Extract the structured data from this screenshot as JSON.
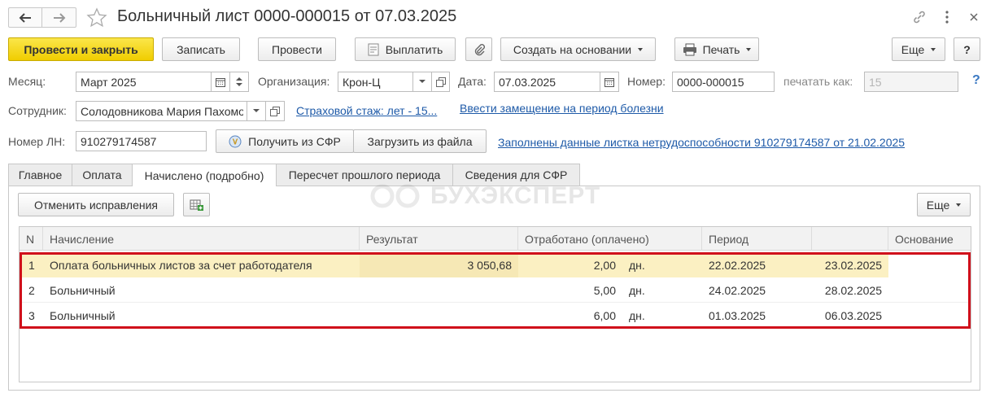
{
  "title": "Больничный лист 0000-000015 от 07.03.2025",
  "toolbar": {
    "post_close": "Провести и закрыть",
    "save": "Записать",
    "post": "Провести",
    "pay": "Выплатить",
    "create_based": "Создать на основании",
    "print": "Печать",
    "more": "Еще",
    "help": "?"
  },
  "form": {
    "month_label": "Месяц:",
    "month_value": "Март 2025",
    "org_label": "Организация:",
    "org_value": "Крон-Ц",
    "date_label": "Дата:",
    "date_value": "07.03.2025",
    "number_label": "Номер:",
    "number_value": "0000-000015",
    "print_as_label": "печатать как:",
    "print_as_value": "15",
    "employee_label": "Сотрудник:",
    "employee_value": "Солодовникова Мария Пахомовна",
    "insurance_link": "Страховой стаж: лет - 15...",
    "substitute_link": "Ввести замещение на период болезни",
    "ln_label": "Номер ЛН:",
    "ln_value": "910279174587",
    "get_sfr": "Получить из СФР",
    "load_file": "Загрузить из файла",
    "filled_link": "Заполнены данные листка нетрудоспособности 910279174587 от 21.02.2025"
  },
  "tabs": [
    "Главное",
    "Оплата",
    "Начислено (подробно)",
    "Пересчет прошлого периода",
    "Сведения для СФР"
  ],
  "active_tab": 2,
  "panel": {
    "cancel_fix": "Отменить исправления",
    "more": "Еще",
    "watermark": "БУХЭКСПЕРТ"
  },
  "table": {
    "headers": [
      "N",
      "Начисление",
      "Результат",
      "Отработано (оплачено)",
      "Период",
      "",
      "Основание"
    ],
    "rows": [
      {
        "n": "1",
        "accrual": "Оплата больничных листов за счет работодателя",
        "result": "3 050,68",
        "worked": "2,00",
        "unit": "дн.",
        "from": "22.02.2025",
        "to": "23.02.2025",
        "basis": ""
      },
      {
        "n": "2",
        "accrual": "Больничный",
        "result": "",
        "worked": "5,00",
        "unit": "дн.",
        "from": "24.02.2025",
        "to": "28.02.2025",
        "basis": ""
      },
      {
        "n": "3",
        "accrual": "Больничный",
        "result": "",
        "worked": "6,00",
        "unit": "дн.",
        "from": "01.03.2025",
        "to": "06.03.2025",
        "basis": ""
      }
    ]
  },
  "colors": {
    "primary": "#f4d20c",
    "link": "#1e5aa8",
    "highlight_row": "#fbf0c2",
    "selection_frame": "#d0101b"
  }
}
